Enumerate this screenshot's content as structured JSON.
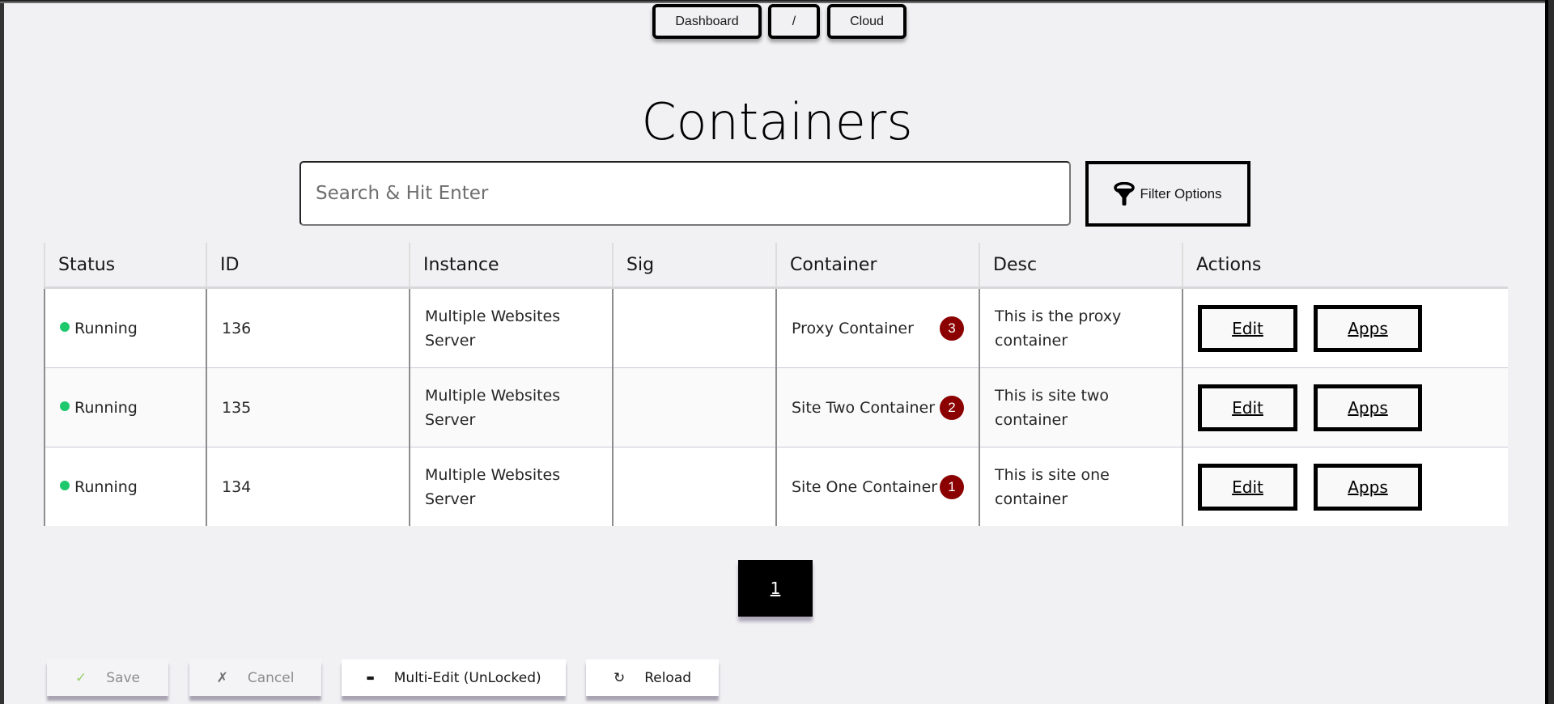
{
  "breadcrumb": {
    "items": [
      {
        "label": "Dashboard"
      },
      {
        "label": "/"
      },
      {
        "label": "Cloud"
      }
    ]
  },
  "header": {
    "title": "Containers"
  },
  "search": {
    "placeholder": "Search & Hit Enter",
    "value": ""
  },
  "filter": {
    "label": "Filter Options",
    "icon": "funnel-icon"
  },
  "table": {
    "columns": [
      "Status",
      "ID",
      "Instance",
      "Sig",
      "Container",
      "Desc",
      "Actions"
    ],
    "rows": [
      {
        "status": "Running",
        "id": "136",
        "instance": "Multiple Websites Server",
        "sig": "",
        "container": "Proxy Container",
        "badge": "3",
        "desc": "This is the proxy container",
        "edit": "Edit",
        "apps": "Apps"
      },
      {
        "status": "Running",
        "id": "135",
        "instance": "Multiple Websites Server",
        "sig": "",
        "container": "Site Two Container",
        "badge": "2",
        "desc": "This is site two container",
        "edit": "Edit",
        "apps": "Apps"
      },
      {
        "status": "Running",
        "id": "134",
        "instance": "Multiple Websites Server",
        "sig": "",
        "container": "Site One Container",
        "badge": "1",
        "desc": "This is site one container",
        "edit": "Edit",
        "apps": "Apps"
      }
    ]
  },
  "pagination": {
    "current": "1"
  },
  "toolbar": {
    "save": {
      "label": "Save",
      "icon": "✓"
    },
    "cancel": {
      "label": "Cancel",
      "icon": "✗"
    },
    "multi_edit": {
      "label": "Multi-Edit (UnLocked)",
      "icon": "▬"
    },
    "reload": {
      "label": "Reload",
      "icon": "↻"
    }
  },
  "colors": {
    "status_running": "#1ec96d",
    "badge": "#8b0000",
    "background": "#f1f1f3"
  }
}
